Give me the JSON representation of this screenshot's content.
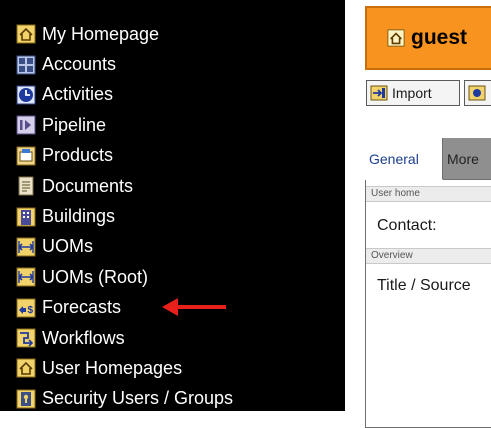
{
  "sidebar": {
    "items": [
      {
        "label": "My Homepage",
        "icon": "home-icon"
      },
      {
        "label": "Accounts",
        "icon": "accounts-icon"
      },
      {
        "label": "Activities",
        "icon": "clock-icon"
      },
      {
        "label": "Pipeline",
        "icon": "pipeline-icon"
      },
      {
        "label": "Products",
        "icon": "products-icon"
      },
      {
        "label": "Documents",
        "icon": "document-icon"
      },
      {
        "label": "Buildings",
        "icon": "building-icon"
      },
      {
        "label": "UOMs",
        "icon": "uom-icon"
      },
      {
        "label": "UOMs (Root)",
        "icon": "uom-root-icon"
      },
      {
        "label": "Forecasts",
        "icon": "forecast-icon"
      },
      {
        "label": "Workflows",
        "icon": "workflow-icon"
      },
      {
        "label": "User Homepages",
        "icon": "home-icon"
      },
      {
        "label": "Security Users / Groups",
        "icon": "security-icon"
      }
    ],
    "highlighted_item": "Forecasts",
    "annotation_color": "#e8201c"
  },
  "header": {
    "user_label": "guest",
    "banner_color": "#f7931e"
  },
  "toolbar": {
    "import_label": "Import",
    "second_label": ""
  },
  "form": {
    "tabs": [
      {
        "label": "General",
        "active": true
      },
      {
        "label": "More",
        "active": false
      }
    ],
    "sections": [
      {
        "heading": "User home",
        "field_label": "Contact:"
      },
      {
        "heading": "Overview",
        "field_label": "Title / Source"
      }
    ]
  }
}
